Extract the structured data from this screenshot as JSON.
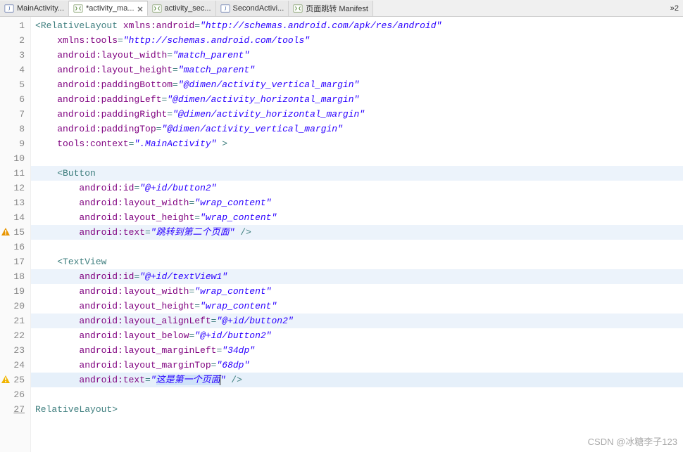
{
  "tabs": [
    {
      "label": "MainActivity...",
      "icon": "java"
    },
    {
      "label": "*activity_ma...",
      "icon": "xml",
      "active": true,
      "closeable": true
    },
    {
      "label": "activity_sec...",
      "icon": "xml"
    },
    {
      "label": "SecondActivi...",
      "icon": "java"
    },
    {
      "label": "页面跳转 Manifest",
      "icon": "xml"
    }
  ],
  "tabbar_more": "»2",
  "code_lines": [
    {
      "n": 1,
      "ind": "",
      "open": "<",
      "tag": "RelativeLayout",
      "sp": " ",
      "attr": "xmlns:android",
      "eq": "=",
      "val": "\"http://schemas.android.com/apk/res/android\""
    },
    {
      "n": 2,
      "ind": "    ",
      "attr": "xmlns:tools",
      "eq": "=",
      "val": "\"http://schemas.android.com/tools\""
    },
    {
      "n": 3,
      "ind": "    ",
      "attr": "android:layout_width",
      "eq": "=",
      "val": "\"match_parent\""
    },
    {
      "n": 4,
      "ind": "    ",
      "attr": "android:layout_height",
      "eq": "=",
      "val": "\"match_parent\""
    },
    {
      "n": 5,
      "ind": "    ",
      "attr": "android:paddingBottom",
      "eq": "=",
      "val": "\"@dimen/activity_vertical_margin\""
    },
    {
      "n": 6,
      "ind": "    ",
      "attr": "android:paddingLeft",
      "eq": "=",
      "val": "\"@dimen/activity_horizontal_margin\""
    },
    {
      "n": 7,
      "ind": "    ",
      "attr": "android:paddingRight",
      "eq": "=",
      "val": "\"@dimen/activity_horizontal_margin\""
    },
    {
      "n": 8,
      "ind": "    ",
      "attr": "android:paddingTop",
      "eq": "=",
      "val": "\"@dimen/activity_vertical_margin\""
    },
    {
      "n": 9,
      "ind": "    ",
      "attr": "tools:context",
      "eq": "=",
      "val": "\".MainActivity\"",
      "tail": " >"
    },
    {
      "n": 10,
      "blank": true
    },
    {
      "n": 11,
      "hl": true,
      "ind": "    ",
      "open": "<",
      "tag": "Button"
    },
    {
      "n": 12,
      "ind": "        ",
      "attr": "android:id",
      "eq": "=",
      "val": "\"@+id/button2\""
    },
    {
      "n": 13,
      "ind": "        ",
      "attr": "android:layout_width",
      "eq": "=",
      "val": "\"wrap_content\""
    },
    {
      "n": 14,
      "ind": "        ",
      "attr": "android:layout_height",
      "eq": "=",
      "val": "\"wrap_content\""
    },
    {
      "n": 15,
      "hl": true,
      "marker": "warn",
      "ind": "        ",
      "attr": "android:text",
      "eq": "=",
      "val": "\"跳转到第二个页面\"",
      "tail": " />"
    },
    {
      "n": 16,
      "blank": true
    },
    {
      "n": 17,
      "ind": "    ",
      "open": "<",
      "tag": "TextView"
    },
    {
      "n": 18,
      "hl": true,
      "ind": "        ",
      "attr": "android:id",
      "eq": "=",
      "val": "\"@+id/textView1\""
    },
    {
      "n": 19,
      "ind": "        ",
      "attr": "android:layout_width",
      "eq": "=",
      "val": "\"wrap_content\""
    },
    {
      "n": 20,
      "ind": "        ",
      "attr": "android:layout_height",
      "eq": "=",
      "val": "\"wrap_content\""
    },
    {
      "n": 21,
      "hl": true,
      "ind": "        ",
      "attr": "android:layout_alignLeft",
      "eq": "=",
      "val": "\"@+id/button2\""
    },
    {
      "n": 22,
      "ind": "        ",
      "attr": "android:layout_below",
      "eq": "=",
      "val": "\"@+id/button2\""
    },
    {
      "n": 23,
      "ind": "        ",
      "attr": "android:layout_marginLeft",
      "eq": "=",
      "val": "\"34dp\""
    },
    {
      "n": 24,
      "ind": "        ",
      "attr": "android:layout_marginTop",
      "eq": "=",
      "val": "\"68dp\""
    },
    {
      "n": 25,
      "caret": true,
      "marker": "warn2",
      "ind": "        ",
      "attr": "android:text",
      "eq": "=",
      "val": "\"这是第一个页面\"",
      "tail": " />",
      "selected": true
    },
    {
      "n": 26,
      "blank": true
    },
    {
      "n": 27,
      "last": true,
      "ind": "",
      "open": "</",
      "tag": "RelativeLayout",
      "close": ">"
    }
  ],
  "watermark": "CSDN @冰糖李子123"
}
